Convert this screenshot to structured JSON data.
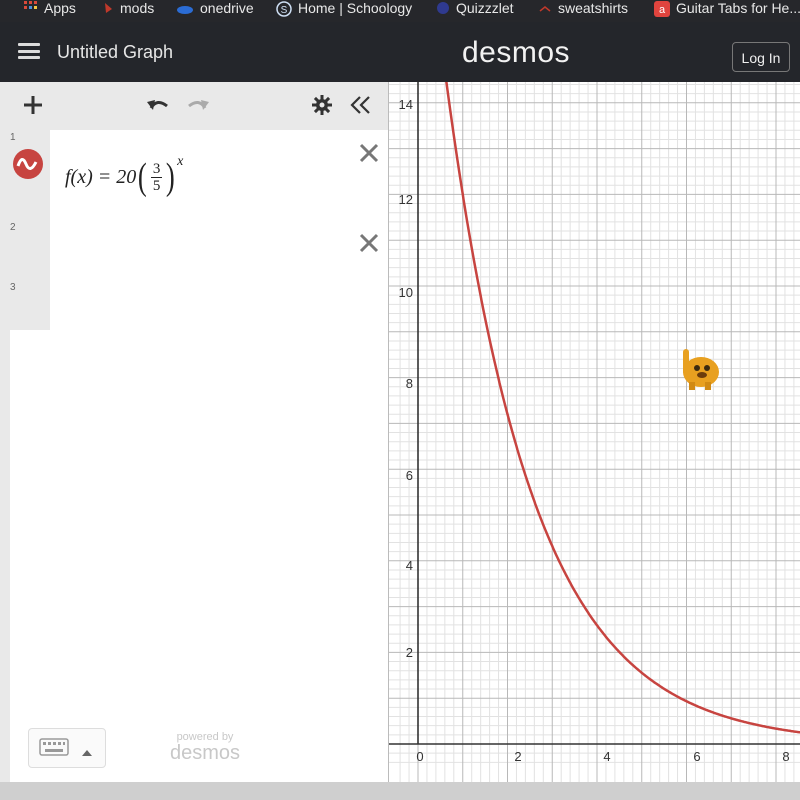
{
  "bookmarks": [
    {
      "label": "Apps",
      "icon": "apps-grid-icon",
      "color": "#d94a3a"
    },
    {
      "label": "mods",
      "icon": "mods-icon",
      "color": "#c0392b"
    },
    {
      "label": "onedrive",
      "icon": "onedrive-cloud-icon",
      "color": "#2b6cd4"
    },
    {
      "label": "Home | Schoology",
      "icon": "schoology-s-icon",
      "color": "#4a90d9"
    },
    {
      "label": "Quizzzlet",
      "icon": "quizlet-icon",
      "color": "#2f3a8f"
    },
    {
      "label": "sweatshirts",
      "icon": "sweatshirts-icon",
      "color": "#c0392b"
    },
    {
      "label": "Guitar Tabs for He...",
      "icon": "a-letter-icon",
      "color": "#e0443e"
    }
  ],
  "header": {
    "menu_icon": "hamburger-icon",
    "title": "Untitled Graph",
    "logo": "desmos",
    "login_label": "Log In"
  },
  "toolbar": {
    "add_icon": "plus-icon",
    "undo_icon": "undo-icon",
    "redo_icon": "redo-icon",
    "settings_icon": "gear-icon",
    "collapse_icon": "double-chevron-left-icon"
  },
  "expressions": [
    {
      "row": "1",
      "has_expr": true,
      "lhs": "f(x) = 20",
      "numerator": "3",
      "denominator": "5",
      "exponent": "x",
      "color": "#c74440"
    },
    {
      "row": "2",
      "has_expr": false
    },
    {
      "row": "3",
      "has_expr": false
    }
  ],
  "footer": {
    "keyboard_icon": "keyboard-icon",
    "powered_by": "powered by",
    "powered_brand": "desmos"
  },
  "graph": {
    "y_tick_labels": [
      "14",
      "12",
      "10",
      "8",
      "6",
      "4",
      "2"
    ],
    "x_tick_labels": [
      "0",
      "2",
      "4",
      "6",
      "8"
    ],
    "curve_color": "#c74440",
    "cursor_icon": "jake-dog-cursor-icon"
  }
}
